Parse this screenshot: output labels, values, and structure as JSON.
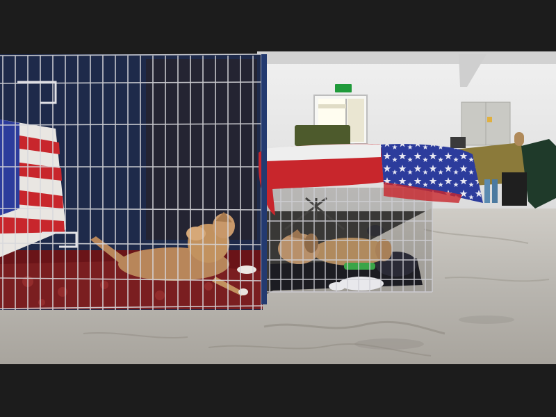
{
  "photo": {
    "subjects": [
      "dog-left",
      "dog-right"
    ],
    "exit_sign_text": ""
  },
  "colors": {
    "wall": "#e6e6e6",
    "floor": "#b9b6b0",
    "cage_wire": "#d8d8dc",
    "dog_fur": "#b8865a",
    "flag_red": "#c8262c",
    "flag_blue": "#2c3c9c",
    "letterbox": "#1c1c1c"
  }
}
